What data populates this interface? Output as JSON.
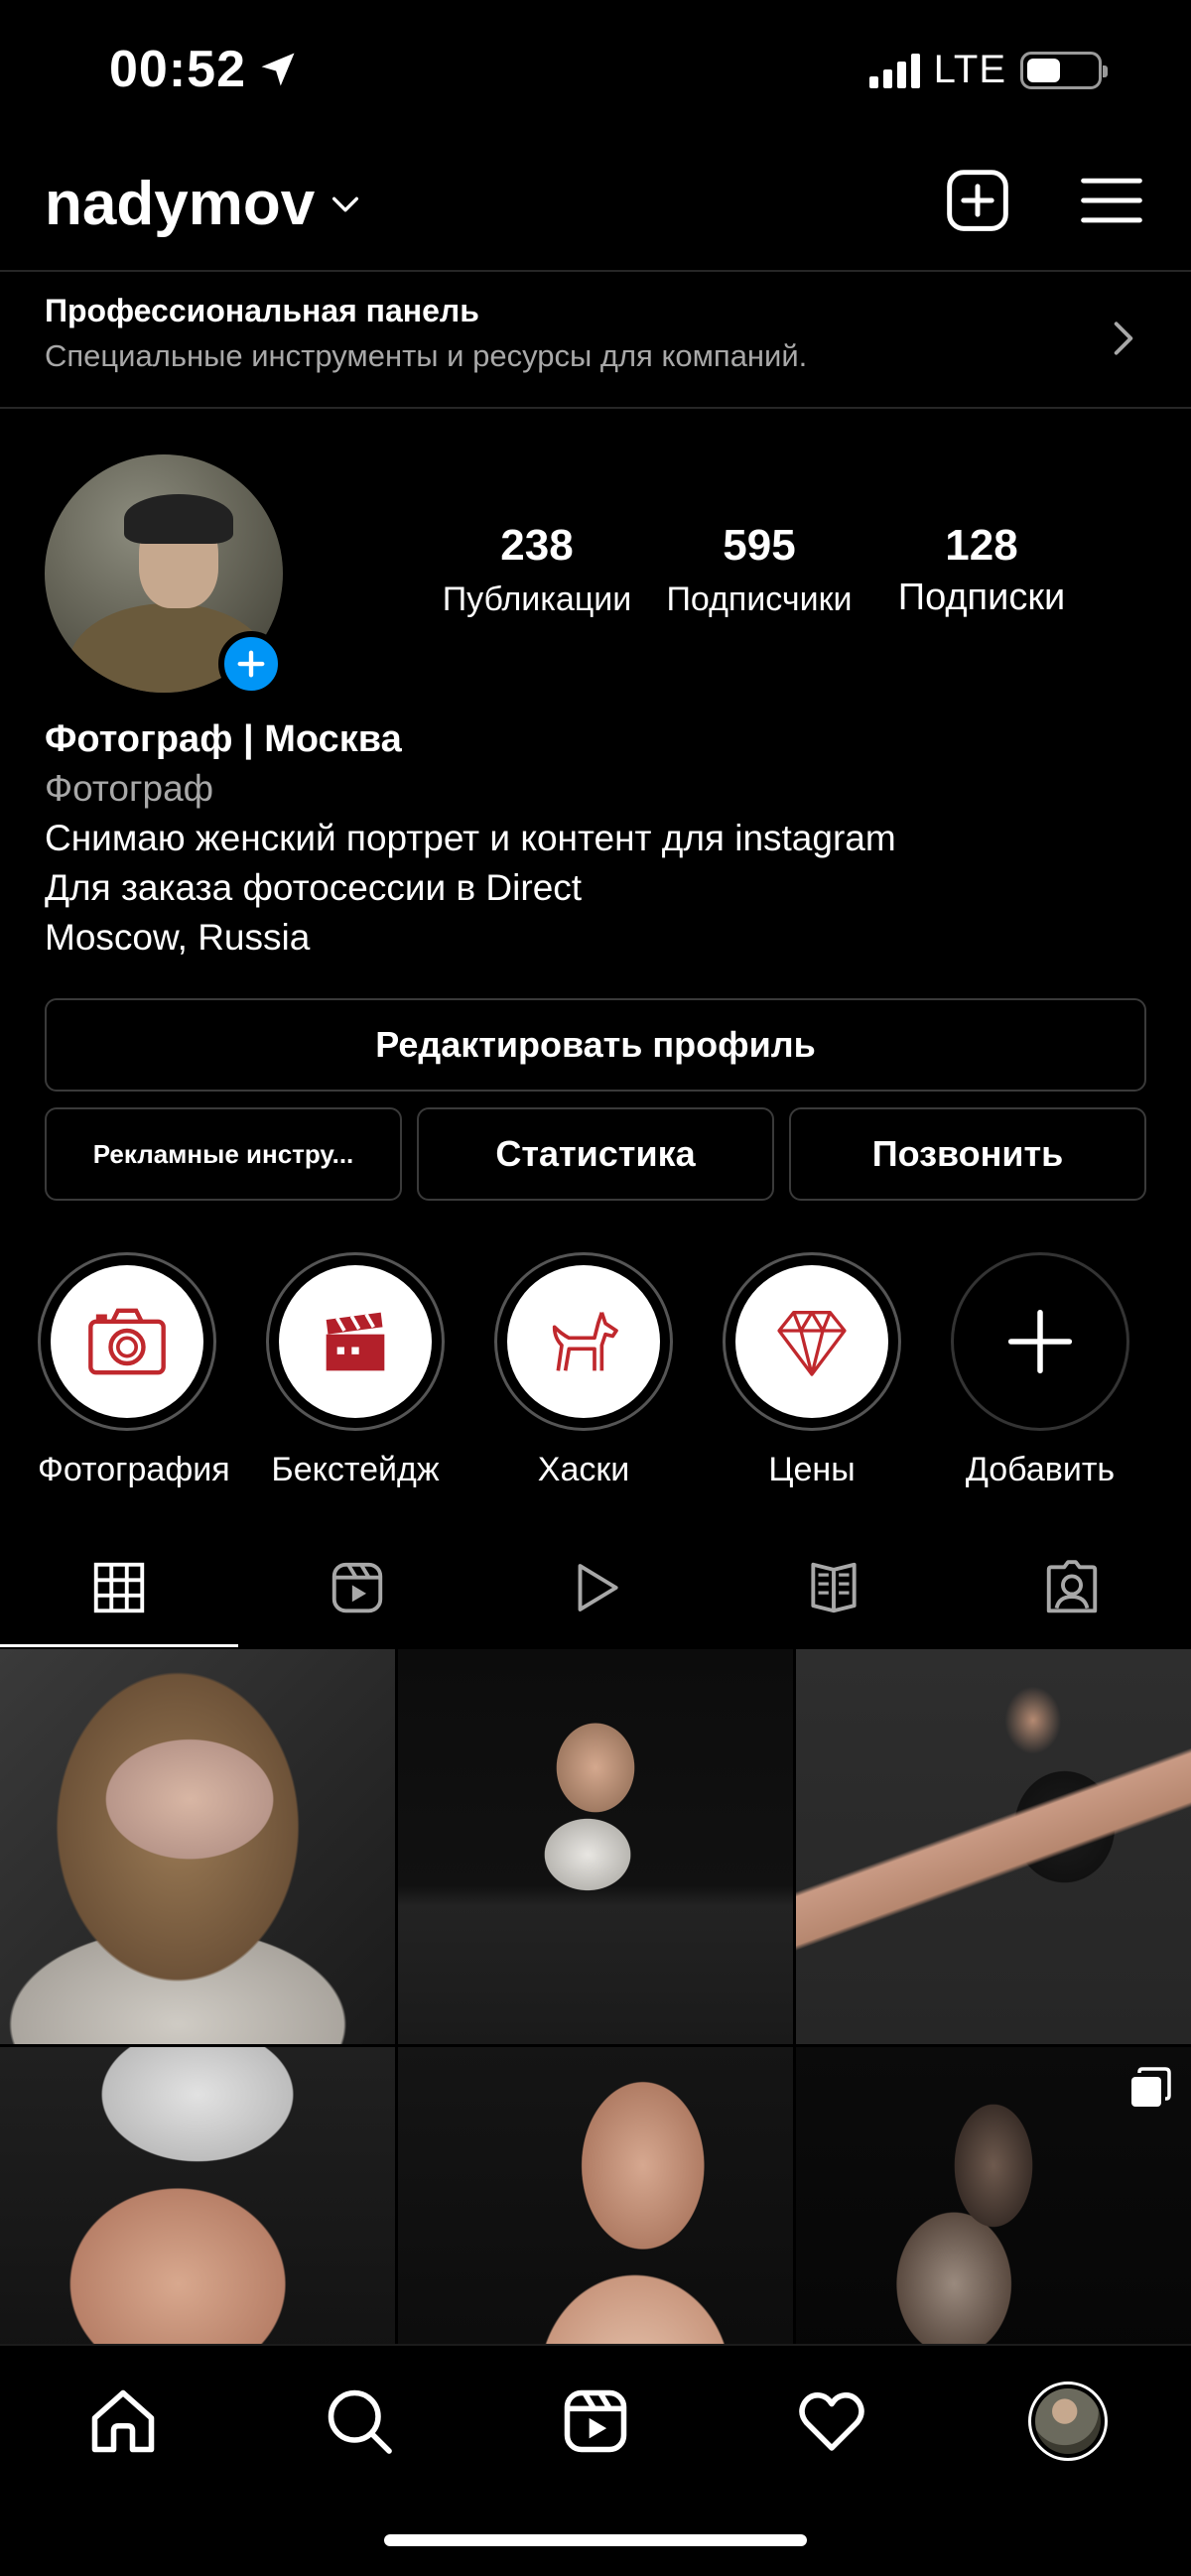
{
  "status_bar": {
    "time": "00:52",
    "network": "LTE",
    "battery_level": 0.48
  },
  "header": {
    "username": "nadymov"
  },
  "pro_panel": {
    "title": "Профессиональная панель",
    "subtitle": "Специальные инструменты и ресурсы для компаний."
  },
  "stats": [
    {
      "value": "238",
      "label": "Публикации"
    },
    {
      "value": "595",
      "label": "Подписчики"
    },
    {
      "value": "128",
      "label": "Подписки"
    }
  ],
  "bio": {
    "name": "Фотограф | Москва",
    "category": "Фотограф",
    "line1": "Снимаю женский портрет и контент для instagram",
    "line2": "Для заказа фотосессии в Direct",
    "line3": "Moscow, Russia"
  },
  "buttons": {
    "edit_profile": "Редактировать профиль",
    "ad_tools": "Рекламные инстру...",
    "insights": "Статистика",
    "call": "Позвонить"
  },
  "highlights": [
    {
      "label": "Фотография",
      "icon": "camera-icon"
    },
    {
      "label": "Бекстейдж",
      "icon": "clapperboard-icon"
    },
    {
      "label": "Хаски",
      "icon": "husky-icon"
    },
    {
      "label": "Цены",
      "icon": "diamond-icon"
    },
    {
      "label": "Добавить",
      "icon": "plus-icon"
    }
  ],
  "tabs": [
    {
      "icon": "grid-icon",
      "active": true
    },
    {
      "icon": "reels-icon",
      "active": false
    },
    {
      "icon": "video-play-icon",
      "active": false
    },
    {
      "icon": "guide-icon",
      "active": false
    },
    {
      "icon": "tagged-icon",
      "active": false
    }
  ],
  "colors": {
    "background": "#000000",
    "accent_blue": "#0095f6",
    "highlight_icon_red": "#c0282d",
    "secondary_text": "#a8a8a8"
  }
}
